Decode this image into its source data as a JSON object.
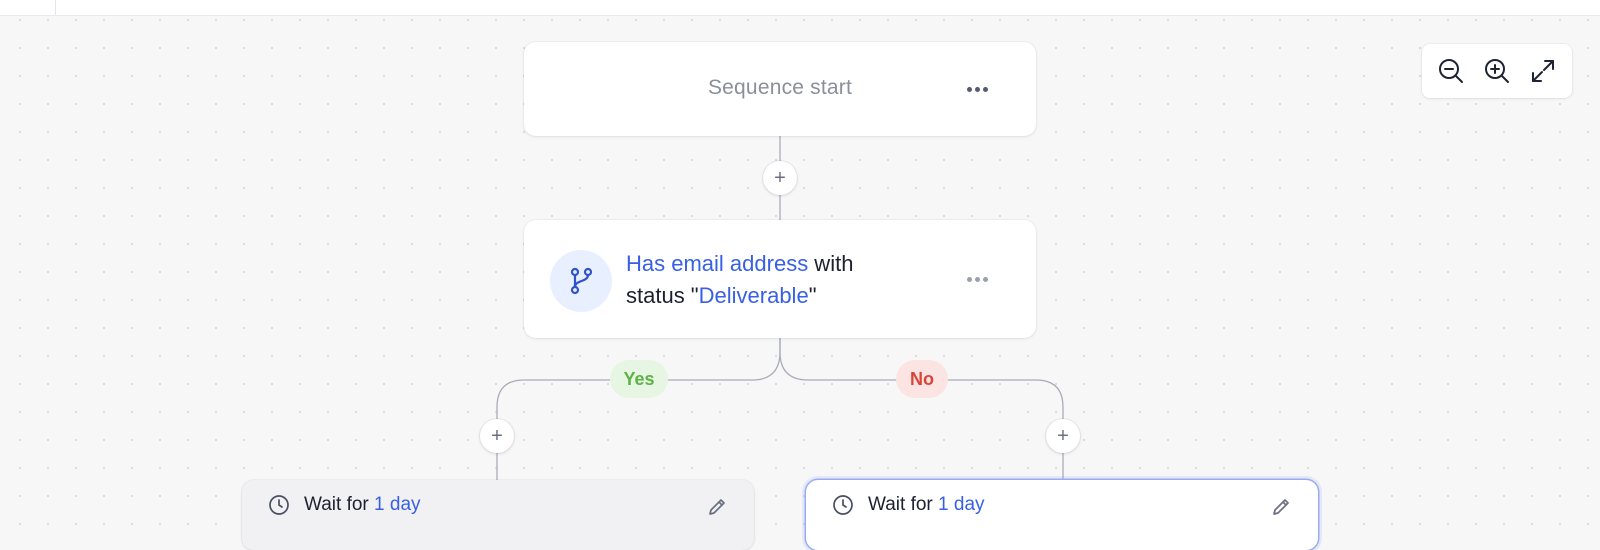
{
  "sequence_start": {
    "title": "Sequence start",
    "menu_icon": "more-horizontal-icon"
  },
  "add_step": {
    "symbol": "+"
  },
  "condition": {
    "icon": "git-branch-icon",
    "text_1": "Has email address",
    "text_2": " with",
    "text_3": "status \"",
    "text_4": "Deliverable",
    "text_5": "\"",
    "menu_icon": "more-horizontal-icon"
  },
  "branches": {
    "yes_label": "Yes",
    "no_label": "No"
  },
  "wait_left": {
    "prefix": "Wait for ",
    "value": "1 day",
    "icon": "clock-icon",
    "edit_icon": "pencil-icon"
  },
  "wait_right": {
    "prefix": "Wait for ",
    "value": "1 day",
    "icon": "clock-icon",
    "edit_icon": "pencil-icon"
  },
  "zoom_controls": {
    "zoom_out_icon": "zoom-out-icon",
    "zoom_in_icon": "zoom-in-icon",
    "fit_icon": "expand-icon"
  },
  "colors": {
    "accent": "#3860e6",
    "yes_text": "#5cb346",
    "yes_bg": "#e6f6e2",
    "no_text": "#d9453a",
    "no_bg": "#fbe4e1",
    "canvas_bg": "#f7f7f8"
  }
}
